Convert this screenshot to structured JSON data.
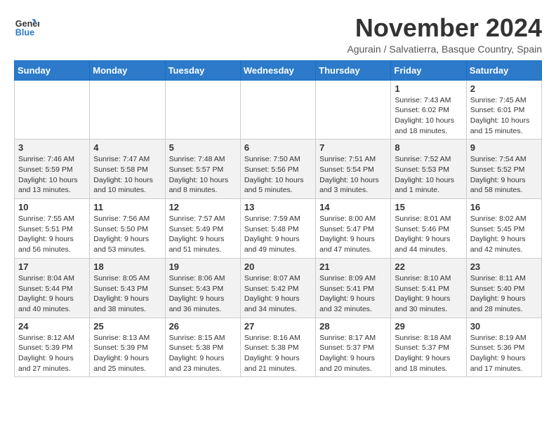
{
  "logo": {
    "line1": "General",
    "line2": "Blue"
  },
  "title": "November 2024",
  "subtitle": "Agurain / Salvatierra, Basque Country, Spain",
  "weekdays": [
    "Sunday",
    "Monday",
    "Tuesday",
    "Wednesday",
    "Thursday",
    "Friday",
    "Saturday"
  ],
  "weeks": [
    [
      {
        "day": "",
        "info": ""
      },
      {
        "day": "",
        "info": ""
      },
      {
        "day": "",
        "info": ""
      },
      {
        "day": "",
        "info": ""
      },
      {
        "day": "",
        "info": ""
      },
      {
        "day": "1",
        "info": "Sunrise: 7:43 AM\nSunset: 6:02 PM\nDaylight: 10 hours and 18 minutes."
      },
      {
        "day": "2",
        "info": "Sunrise: 7:45 AM\nSunset: 6:01 PM\nDaylight: 10 hours and 15 minutes."
      }
    ],
    [
      {
        "day": "3",
        "info": "Sunrise: 7:46 AM\nSunset: 5:59 PM\nDaylight: 10 hours and 13 minutes."
      },
      {
        "day": "4",
        "info": "Sunrise: 7:47 AM\nSunset: 5:58 PM\nDaylight: 10 hours and 10 minutes."
      },
      {
        "day": "5",
        "info": "Sunrise: 7:48 AM\nSunset: 5:57 PM\nDaylight: 10 hours and 8 minutes."
      },
      {
        "day": "6",
        "info": "Sunrise: 7:50 AM\nSunset: 5:56 PM\nDaylight: 10 hours and 5 minutes."
      },
      {
        "day": "7",
        "info": "Sunrise: 7:51 AM\nSunset: 5:54 PM\nDaylight: 10 hours and 3 minutes."
      },
      {
        "day": "8",
        "info": "Sunrise: 7:52 AM\nSunset: 5:53 PM\nDaylight: 10 hours and 1 minute."
      },
      {
        "day": "9",
        "info": "Sunrise: 7:54 AM\nSunset: 5:52 PM\nDaylight: 9 hours and 58 minutes."
      }
    ],
    [
      {
        "day": "10",
        "info": "Sunrise: 7:55 AM\nSunset: 5:51 PM\nDaylight: 9 hours and 56 minutes."
      },
      {
        "day": "11",
        "info": "Sunrise: 7:56 AM\nSunset: 5:50 PM\nDaylight: 9 hours and 53 minutes."
      },
      {
        "day": "12",
        "info": "Sunrise: 7:57 AM\nSunset: 5:49 PM\nDaylight: 9 hours and 51 minutes."
      },
      {
        "day": "13",
        "info": "Sunrise: 7:59 AM\nSunset: 5:48 PM\nDaylight: 9 hours and 49 minutes."
      },
      {
        "day": "14",
        "info": "Sunrise: 8:00 AM\nSunset: 5:47 PM\nDaylight: 9 hours and 47 minutes."
      },
      {
        "day": "15",
        "info": "Sunrise: 8:01 AM\nSunset: 5:46 PM\nDaylight: 9 hours and 44 minutes."
      },
      {
        "day": "16",
        "info": "Sunrise: 8:02 AM\nSunset: 5:45 PM\nDaylight: 9 hours and 42 minutes."
      }
    ],
    [
      {
        "day": "17",
        "info": "Sunrise: 8:04 AM\nSunset: 5:44 PM\nDaylight: 9 hours and 40 minutes."
      },
      {
        "day": "18",
        "info": "Sunrise: 8:05 AM\nSunset: 5:43 PM\nDaylight: 9 hours and 38 minutes."
      },
      {
        "day": "19",
        "info": "Sunrise: 8:06 AM\nSunset: 5:43 PM\nDaylight: 9 hours and 36 minutes."
      },
      {
        "day": "20",
        "info": "Sunrise: 8:07 AM\nSunset: 5:42 PM\nDaylight: 9 hours and 34 minutes."
      },
      {
        "day": "21",
        "info": "Sunrise: 8:09 AM\nSunset: 5:41 PM\nDaylight: 9 hours and 32 minutes."
      },
      {
        "day": "22",
        "info": "Sunrise: 8:10 AM\nSunset: 5:41 PM\nDaylight: 9 hours and 30 minutes."
      },
      {
        "day": "23",
        "info": "Sunrise: 8:11 AM\nSunset: 5:40 PM\nDaylight: 9 hours and 28 minutes."
      }
    ],
    [
      {
        "day": "24",
        "info": "Sunrise: 8:12 AM\nSunset: 5:39 PM\nDaylight: 9 hours and 27 minutes."
      },
      {
        "day": "25",
        "info": "Sunrise: 8:13 AM\nSunset: 5:39 PM\nDaylight: 9 hours and 25 minutes."
      },
      {
        "day": "26",
        "info": "Sunrise: 8:15 AM\nSunset: 5:38 PM\nDaylight: 9 hours and 23 minutes."
      },
      {
        "day": "27",
        "info": "Sunrise: 8:16 AM\nSunset: 5:38 PM\nDaylight: 9 hours and 21 minutes."
      },
      {
        "day": "28",
        "info": "Sunrise: 8:17 AM\nSunset: 5:37 PM\nDaylight: 9 hours and 20 minutes."
      },
      {
        "day": "29",
        "info": "Sunrise: 8:18 AM\nSunset: 5:37 PM\nDaylight: 9 hours and 18 minutes."
      },
      {
        "day": "30",
        "info": "Sunrise: 8:19 AM\nSunset: 5:36 PM\nDaylight: 9 hours and 17 minutes."
      }
    ]
  ]
}
